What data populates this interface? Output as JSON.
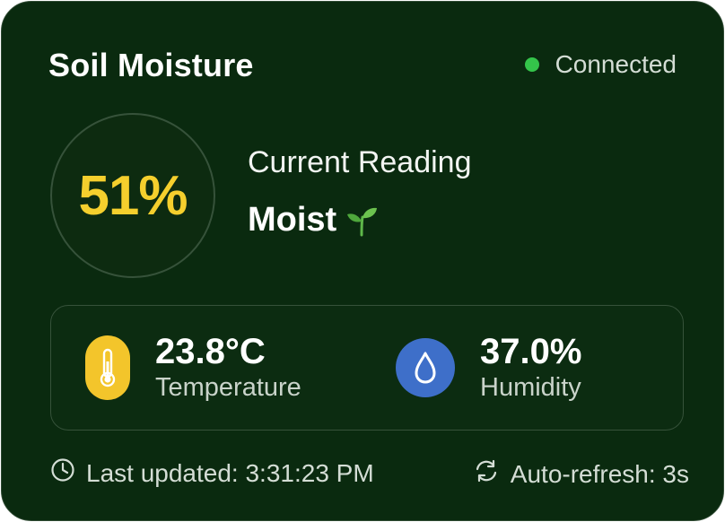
{
  "card": {
    "title": "Soil Moisture",
    "status": {
      "label": "Connected",
      "icon": "status-dot-icon",
      "color": "#34c44a"
    }
  },
  "reading": {
    "moisture_value": "51%",
    "moisture_percent": 51,
    "label": "Current Reading",
    "state": "Moist",
    "state_icon": "sprout-icon",
    "value_color": "#f5cf2d"
  },
  "metrics": {
    "temperature": {
      "value": "23.8°C",
      "label": "Temperature",
      "icon": "thermometer-icon",
      "color": "#f3c52b"
    },
    "humidity": {
      "value": "37.0%",
      "label": "Humidity",
      "icon": "water-drop-icon",
      "color": "#3e6fc9"
    }
  },
  "footer": {
    "last_updated": "Last updated: 3:31:23 PM",
    "last_updated_icon": "clock-icon",
    "auto_refresh": "Auto-refresh: 3s",
    "auto_refresh_icon": "refresh-icon"
  }
}
